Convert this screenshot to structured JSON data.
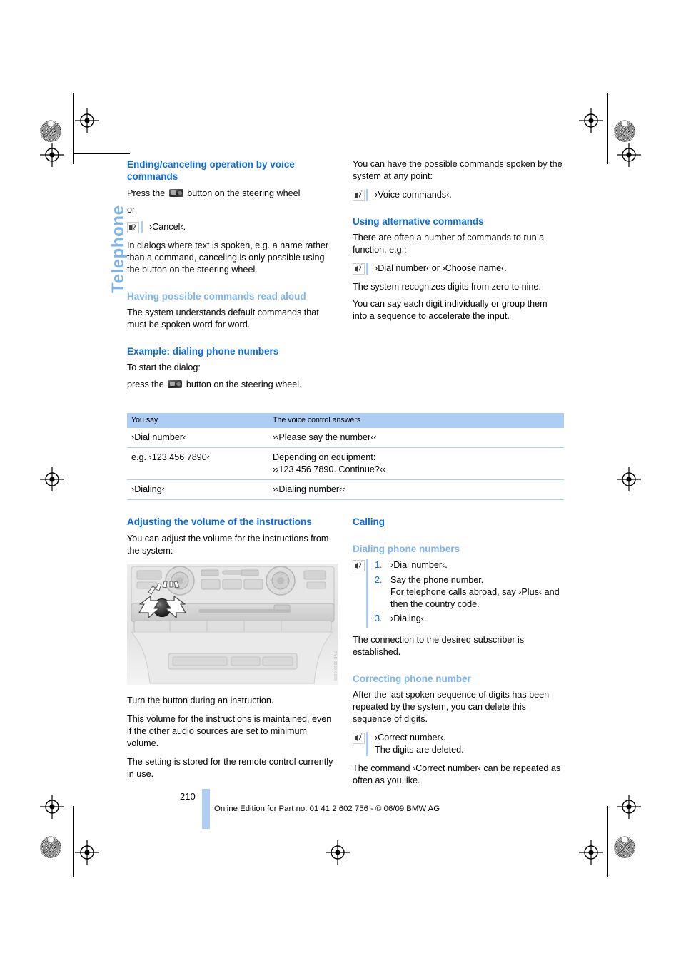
{
  "sidetab": {
    "label": "Telephone"
  },
  "left_column": {
    "h_ending": "Ending/canceling operation by voice commands",
    "p_press_pre": "Press the",
    "p_press_post": "button on the steering wheel",
    "p_or": "or",
    "vc_cancel": "›Cancel‹.",
    "p_dialogs": "In dialogs where text is spoken, e.g. a name rather than a command, canceling is only possible using the button on the steering wheel.",
    "h_having": "Having possible commands read aloud",
    "p_system_understands": "The system understands default commands that must be spoken word for word.",
    "h_example": "Example: dialing phone numbers",
    "p_to_start": "To start the dialog:",
    "p_press2_pre": "press the",
    "p_press2_post": "button on the steering wheel.",
    "h_adjusting": "Adjusting the volume of the instructions",
    "p_adjust": "You can adjust the volume for the instructions from the system:",
    "p_turn": "Turn the button during an instruction.",
    "p_maintained": "This volume for the instructions is maintained, even if the other audio sources are set to minimum volume.",
    "p_stored": "The setting is stored for the remote control currently in use.",
    "photo_id": "SVE 0390 0005"
  },
  "right_column": {
    "p_spoken": "You can have the possible commands spoken by the system at any point:",
    "vc_voice": "›Voice commands‹.",
    "h_using_alt": "Using alternative commands",
    "p_often": "There are often a number of commands to run a function, e.g.:",
    "vc_dial_or_choose": "›Dial number‹ or ›Choose name‹.",
    "p_recognizes": "The system recognizes digits from zero to nine.",
    "p_each_digit": "You can say each digit individually or group them into a sequence to accelerate the input.",
    "h_calling": "Calling",
    "h_dialing": "Dialing phone numbers",
    "steps": [
      {
        "num": "1.",
        "text": "›Dial number‹."
      },
      {
        "num": "2.",
        "text": "Say the phone number.\nFor telephone calls abroad, say ›Plus‹ and then the country code."
      },
      {
        "num": "3.",
        "text": "›Dialing‹."
      }
    ],
    "p_connection": "The connection to the desired subscriber is established.",
    "h_correcting": "Correcting phone number",
    "p_after_last": "After the last spoken sequence of digits has been repeated by the system, you can delete this sequence of digits.",
    "vc_correct_1": "›Correct number‹.",
    "vc_correct_2": "The digits are deleted.",
    "p_repeated": "The command ›Correct number‹ can be repeated as often as you like."
  },
  "table": {
    "headers": [
      "You say",
      "The voice control answers"
    ],
    "rows": [
      [
        "›Dial number‹",
        "››Please say the number‹‹"
      ],
      [
        "e.g. ›123 456 7890‹",
        "Depending on equipment:\n››123 456 7890. Continue?‹‹"
      ],
      [
        "›Dialing‹",
        "››Dialing number‹‹"
      ]
    ]
  },
  "footer": {
    "page_number": "210",
    "text": "Online Edition for Part no. 01 41 2 602 756 - © 06/09 BMW AG"
  },
  "colors": {
    "heading_dark_blue": "#0a6ae0",
    "heading_light_blue": "#7fb4ea",
    "rule_blue": "#aecdf5"
  }
}
